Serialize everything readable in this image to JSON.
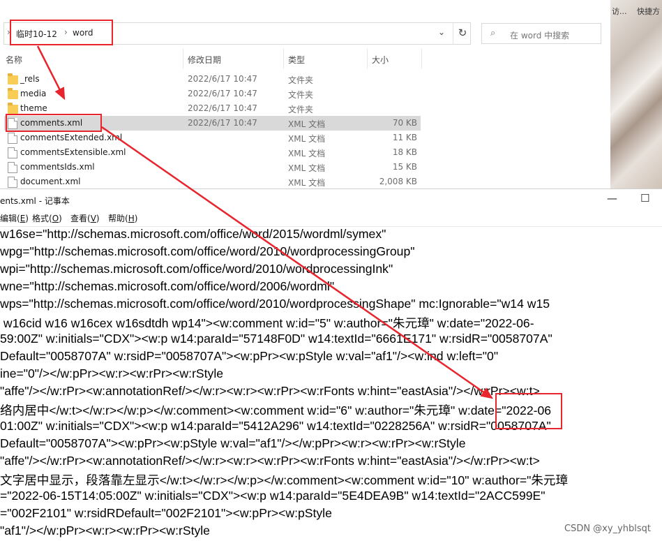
{
  "explorer": {
    "breadcrumb": [
      "临时10-12",
      "word"
    ],
    "search_placeholder": "在 word 中搜索",
    "columns": [
      "名称",
      "修改日期",
      "类型",
      "大小"
    ],
    "files": [
      {
        "name": "_rels",
        "date": "2022/6/17 10:47",
        "type": "文件夹",
        "size": "",
        "kind": "folder"
      },
      {
        "name": "media",
        "date": "2022/6/17 10:47",
        "type": "文件夹",
        "size": "",
        "kind": "folder"
      },
      {
        "name": "theme",
        "date": "2022/6/17 10:47",
        "type": "文件夹",
        "size": "",
        "kind": "folder"
      },
      {
        "name": "comments.xml",
        "date": "2022/6/17 10:47",
        "type": "XML 文档",
        "size": "70 KB",
        "kind": "file",
        "selected": true
      },
      {
        "name": "commentsExtended.xml",
        "date": "",
        "type": "XML 文档",
        "size": "11 KB",
        "kind": "file"
      },
      {
        "name": "commentsExtensible.xml",
        "date": "",
        "type": "XML 文档",
        "size": "18 KB",
        "kind": "file"
      },
      {
        "name": "commentsIds.xml",
        "date": "",
        "type": "XML 文档",
        "size": "15 KB",
        "kind": "file"
      },
      {
        "name": "document.xml",
        "date": "",
        "type": "XML 文档",
        "size": "2,008 KB",
        "kind": "file"
      }
    ]
  },
  "background_photo": {
    "text_left": "访...",
    "text_right": "快捷方"
  },
  "notepad": {
    "title": "ents.xml - 记事本",
    "minimize": "—",
    "maximize": "☐",
    "menu": [
      {
        "label": "编辑",
        "key": "E"
      },
      {
        "label": "格式",
        "key": "O"
      },
      {
        "label": "查看",
        "key": "V"
      },
      {
        "label": "帮助",
        "key": "H"
      }
    ],
    "lines": [
      "w16se=\"http://schemas.microsoft.com/office/word/2015/wordml/symex\"",
      "wpg=\"http://schemas.microsoft.com/office/word/2010/wordprocessingGroup\"",
      "wpi=\"http://schemas.microsoft.com/office/word/2010/wordprocessingInk\"",
      "wne=\"http://schemas.microsoft.com/office/word/2006/wordml\"",
      "wps=\"http://schemas.microsoft.com/office/word/2010/wordprocessingShape\" mc:Ignorable=\"w14 w15",
      " w16cid w16 w16cex w16sdtdh wp14\"><w:comment w:id=\"5\" w:author=\"朱元璋\" w:date=\"2022-06-",
      "59:00Z\" w:initials=\"CDX\"><w:p w14:paraId=\"57148F0D\" w14:textId=\"6661E171\" w:rsidR=\"0058707A\"",
      "Default=\"0058707A\" w:rsidP=\"0058707A\"><w:pPr><w:pStyle w:val=\"af1\"/><w:ind w:left=\"0\"",
      "ine=\"0\"/></w:pPr><w:r><w:rPr><w:rStyle",
      "\"affe\"/></w:rPr><w:annotationRef/></w:r><w:r><w:rPr><w:rFonts w:hint=\"eastAsia\"/></w:rPr><w:t>",
      "络内居中</w:t></w:r></w:p></w:comment><w:comment w:id=\"6\" w:author=\"朱元璋\" w:date=\"2022-06",
      "01:00Z\" w:initials=\"CDX\"><w:p w14:paraId=\"5412A296\" w14:textId=\"0228256A\" w:rsidR=\"0058707A\"",
      "Default=\"0058707A\"><w:pPr><w:pStyle w:val=\"af1\"/></w:pPr><w:r><w:rPr><w:rStyle",
      "\"affe\"/></w:rPr><w:annotationRef/></w:r><w:r><w:rPr><w:rFonts w:hint=\"eastAsia\"/></w:rPr><w:t>",
      "文字居中显示，段落靠左显示</w:t></w:r></w:p></w:comment><w:comment w:id=\"10\" w:author=\"朱元璋",
      "=\"2022-06-15T14:05:00Z\" w:initials=\"CDX\"><w:p w14:paraId=\"5E4DEA9B\" w14:textId=\"2ACC599E\"",
      "=\"002F2101\" w:rsidRDefault=\"002F2101\"><w:pPr><w:pStyle",
      "\"af1\"/></w:pPr><w:r><w:rPr><w:rStyle"
    ],
    "watermark": "CSDN @xy_yhblsqt"
  },
  "annotations": {
    "color": "#e8242d"
  }
}
